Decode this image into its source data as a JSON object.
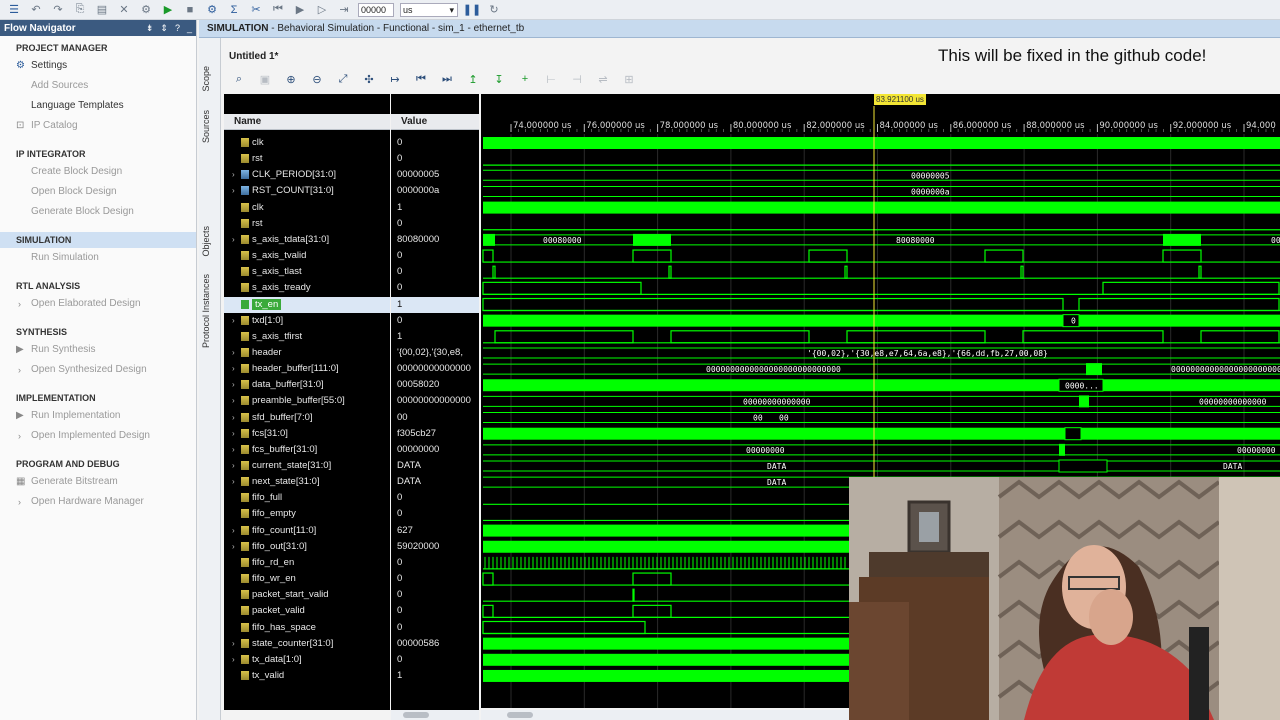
{
  "toolbar": {
    "time_value": "00000",
    "time_unit": "us"
  },
  "flow_navigator": {
    "title": "Flow Navigator",
    "sections": [
      {
        "label": "PROJECT MANAGER",
        "items": [
          {
            "label": "Settings",
            "enabled": true,
            "icon": "gear-icon"
          },
          {
            "label": "Add Sources",
            "enabled": false
          },
          {
            "label": "Language Templates",
            "enabled": true
          },
          {
            "label": "IP Catalog",
            "enabled": false,
            "icon": "ip-icon"
          }
        ]
      },
      {
        "label": "IP INTEGRATOR",
        "items": [
          {
            "label": "Create Block Design",
            "enabled": false
          },
          {
            "label": "Open Block Design",
            "enabled": false
          },
          {
            "label": "Generate Block Design",
            "enabled": false
          }
        ]
      },
      {
        "label": "SIMULATION",
        "active": true,
        "items": [
          {
            "label": "Run Simulation",
            "enabled": false
          }
        ]
      },
      {
        "label": "RTL ANALYSIS",
        "items": [
          {
            "label": "Open Elaborated Design",
            "enabled": false,
            "chevron": true
          }
        ]
      },
      {
        "label": "SYNTHESIS",
        "items": [
          {
            "label": "Run Synthesis",
            "enabled": false,
            "icon": "play-icon"
          },
          {
            "label": "Open Synthesized Design",
            "enabled": false,
            "chevron": true
          }
        ]
      },
      {
        "label": "IMPLEMENTATION",
        "items": [
          {
            "label": "Run Implementation",
            "enabled": false,
            "icon": "play-icon"
          },
          {
            "label": "Open Implemented Design",
            "enabled": false,
            "chevron": true
          }
        ]
      },
      {
        "label": "PROGRAM AND DEBUG",
        "items": [
          {
            "label": "Generate Bitstream",
            "enabled": false,
            "icon": "bitstream-icon"
          },
          {
            "label": "Open Hardware Manager",
            "enabled": false,
            "chevron": true
          }
        ]
      }
    ]
  },
  "sim_header": {
    "bold": "SIMULATION",
    "rest": " - Behavioral Simulation - Functional - sim_1 - ethernet_tb"
  },
  "side_tabs": [
    "Scope",
    "Sources",
    "Objects",
    "Protocol Instances"
  ],
  "wave_window": {
    "title": "Untitled 1*"
  },
  "overlay_note": "This will be fixed in the github code!",
  "columns": {
    "name": "Name",
    "value": "Value"
  },
  "cursor_time": "83.921100 us",
  "time_ticks": [
    "74.000000 us",
    "76.000000 us",
    "78.000000 us",
    "80.000000 us",
    "82.000000 us",
    "84.000000 us",
    "86.000000 us",
    "88.000000 us",
    "90.000000 us",
    "92.000000 us",
    "94.000"
  ],
  "signals": [
    {
      "name": "clk",
      "value": "0",
      "bus": false,
      "kind": "s"
    },
    {
      "name": "rst",
      "value": "0",
      "bus": false,
      "kind": "s"
    },
    {
      "name": "CLK_PERIOD[31:0]",
      "value": "00000005",
      "bus": true,
      "kind": "b"
    },
    {
      "name": "RST_COUNT[31:0]",
      "value": "0000000a",
      "bus": true,
      "kind": "b"
    },
    {
      "name": "clk",
      "value": "1",
      "bus": false,
      "kind": "s"
    },
    {
      "name": "rst",
      "value": "0",
      "bus": false,
      "kind": "s"
    },
    {
      "name": "s_axis_tdata[31:0]",
      "value": "80080000",
      "bus": true,
      "kind": "s"
    },
    {
      "name": "s_axis_tvalid",
      "value": "0",
      "bus": false,
      "kind": "s"
    },
    {
      "name": "s_axis_tlast",
      "value": "0",
      "bus": false,
      "kind": "s"
    },
    {
      "name": "s_axis_tready",
      "value": "0",
      "bus": false,
      "kind": "s"
    },
    {
      "name": "tx_en",
      "value": "1",
      "bus": false,
      "kind": "sel",
      "selected": true
    },
    {
      "name": "txd[1:0]",
      "value": "0",
      "bus": true,
      "kind": "s"
    },
    {
      "name": "s_axis_tfirst",
      "value": "1",
      "bus": false,
      "kind": "s"
    },
    {
      "name": "header",
      "value": "'{00,02},'{30,e8,",
      "bus": true,
      "kind": "s"
    },
    {
      "name": "header_buffer[111:0]",
      "value": "00000000000000",
      "bus": true,
      "kind": "s"
    },
    {
      "name": "data_buffer[31:0]",
      "value": "00058020",
      "bus": true,
      "kind": "s"
    },
    {
      "name": "preamble_buffer[55:0]",
      "value": "00000000000000",
      "bus": true,
      "kind": "s"
    },
    {
      "name": "sfd_buffer[7:0]",
      "value": "00",
      "bus": true,
      "kind": "s"
    },
    {
      "name": "fcs[31:0]",
      "value": "f305cb27",
      "bus": true,
      "kind": "s"
    },
    {
      "name": "fcs_buffer[31:0]",
      "value": "00000000",
      "bus": true,
      "kind": "s"
    },
    {
      "name": "current_state[31:0]",
      "value": "DATA",
      "bus": true,
      "kind": "s"
    },
    {
      "name": "next_state[31:0]",
      "value": "DATA",
      "bus": true,
      "kind": "s"
    },
    {
      "name": "fifo_full",
      "value": "0",
      "bus": false,
      "kind": "s"
    },
    {
      "name": "fifo_empty",
      "value": "0",
      "bus": false,
      "kind": "s"
    },
    {
      "name": "fifo_count[11:0]",
      "value": "627",
      "bus": true,
      "kind": "s"
    },
    {
      "name": "fifo_out[31:0]",
      "value": "59020000",
      "bus": true,
      "kind": "s"
    },
    {
      "name": "fifo_rd_en",
      "value": "0",
      "bus": false,
      "kind": "s"
    },
    {
      "name": "fifo_wr_en",
      "value": "0",
      "bus": false,
      "kind": "s"
    },
    {
      "name": "packet_start_valid",
      "value": "0",
      "bus": false,
      "kind": "s"
    },
    {
      "name": "packet_valid",
      "value": "0",
      "bus": false,
      "kind": "s"
    },
    {
      "name": "fifo_has_space",
      "value": "0",
      "bus": false,
      "kind": "s"
    },
    {
      "name": "state_counter[31:0]",
      "value": "00000586",
      "bus": true,
      "kind": "s"
    },
    {
      "name": "tx_data[1:0]",
      "value": "0",
      "bus": true,
      "kind": "s"
    },
    {
      "name": "tx_valid",
      "value": "1",
      "bus": false,
      "kind": "s"
    }
  ],
  "wave_labels": [
    {
      "row": 2,
      "text": "00000005"
    },
    {
      "row": 3,
      "text": "0000000a"
    },
    {
      "row": 6,
      "text": "00080000"
    },
    {
      "row": 6,
      "text": "80080000"
    },
    {
      "row": 6,
      "text": "00"
    },
    {
      "row": 11,
      "text": "0"
    },
    {
      "row": 13,
      "text": "'{00,02},'{30,e8,e7,64,6a,e8},'{66,dd,fb,27,00,08}"
    },
    {
      "row": 14,
      "text": "0000000000000000000000000000"
    },
    {
      "row": 14,
      "text": "0000000000000000000000000000"
    },
    {
      "row": 15,
      "text": "0000..."
    },
    {
      "row": 16,
      "text": "00000000000000"
    },
    {
      "row": 16,
      "text": "00000000000000"
    },
    {
      "row": 17,
      "text": "00"
    },
    {
      "row": 17,
      "text": "00"
    },
    {
      "row": 19,
      "text": "00000000"
    },
    {
      "row": 19,
      "text": "00000000"
    },
    {
      "row": 20,
      "text": "DATA"
    },
    {
      "row": 20,
      "text": "DATA"
    },
    {
      "row": 21,
      "text": "DATA"
    }
  ],
  "colors": {
    "wave": "#00ff00",
    "wave_dark": "#1e7a1e",
    "cursor": "#f3e635",
    "sim_header": "#c7daee",
    "nav_header": "#3b5a80"
  }
}
